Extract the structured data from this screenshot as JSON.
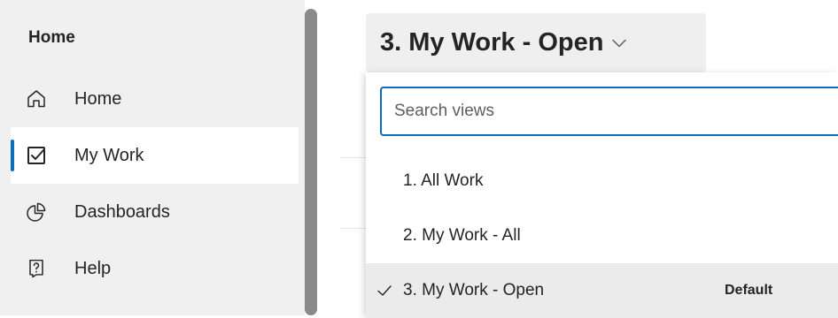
{
  "sidebar": {
    "header": "Home",
    "items": [
      {
        "label": "Home",
        "icon": "home-icon",
        "selected": false
      },
      {
        "label": "My Work",
        "icon": "checkbox-icon",
        "selected": true
      },
      {
        "label": "Dashboards",
        "icon": "pie-chart-icon",
        "selected": false
      },
      {
        "label": "Help",
        "icon": "help-icon",
        "selected": false
      }
    ]
  },
  "view_selector": {
    "title": "3. My Work - Open",
    "chevron": "chevron-down-icon"
  },
  "dropdown": {
    "search_placeholder": "Search views",
    "options": [
      {
        "label": "1. All Work",
        "selected": false,
        "badge": ""
      },
      {
        "label": "2. My Work - All",
        "selected": false,
        "badge": ""
      },
      {
        "label": "3. My Work - Open",
        "selected": true,
        "badge": "Default"
      }
    ]
  },
  "colors": {
    "accent": "#0f6cbd",
    "sidebar_bg": "#f0f0f0",
    "selected_option_bg": "#ebebeb"
  }
}
